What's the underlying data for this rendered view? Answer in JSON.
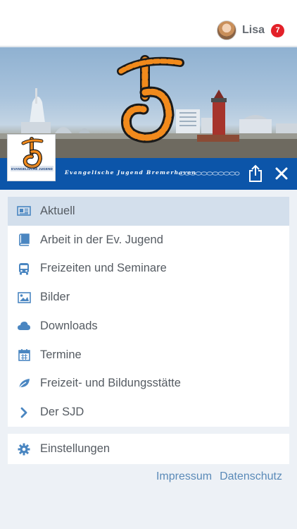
{
  "user": {
    "name": "Lisa",
    "notification_count": "7",
    "avatar_icon": "user-avatar"
  },
  "banner": {
    "strip_title": "Evangelische Jugend Bremerhaven",
    "logo_text": "EVANGELISCHE JUGEND"
  },
  "menu": {
    "items": [
      {
        "label": "Aktuell",
        "icon": "newspaper-icon",
        "active": true
      },
      {
        "label": "Arbeit in der Ev. Jugend",
        "icon": "book-icon",
        "active": false
      },
      {
        "label": "Freizeiten und Seminare",
        "icon": "bus-icon",
        "active": false
      },
      {
        "label": "Bilder",
        "icon": "image-icon",
        "active": false
      },
      {
        "label": "Downloads",
        "icon": "cloud-icon",
        "active": false
      },
      {
        "label": "Termine",
        "icon": "calendar-icon",
        "active": false
      },
      {
        "label": "Freizeit- und Bildungsstätte",
        "icon": "leaf-icon",
        "active": false
      },
      {
        "label": "Der SJD",
        "icon": "chevron-right-icon",
        "active": false
      }
    ],
    "settings": {
      "label": "Einstellungen",
      "icon": "gear-icon"
    }
  },
  "footer": {
    "impressum": "Impressum",
    "datenschutz": "Datenschutz"
  },
  "colors": {
    "accent_blue": "#0c55a9",
    "icon_blue": "#4a86c1",
    "active_bg": "#d3dfec",
    "badge_red": "#e32129",
    "page_bg": "#edf1f6"
  }
}
